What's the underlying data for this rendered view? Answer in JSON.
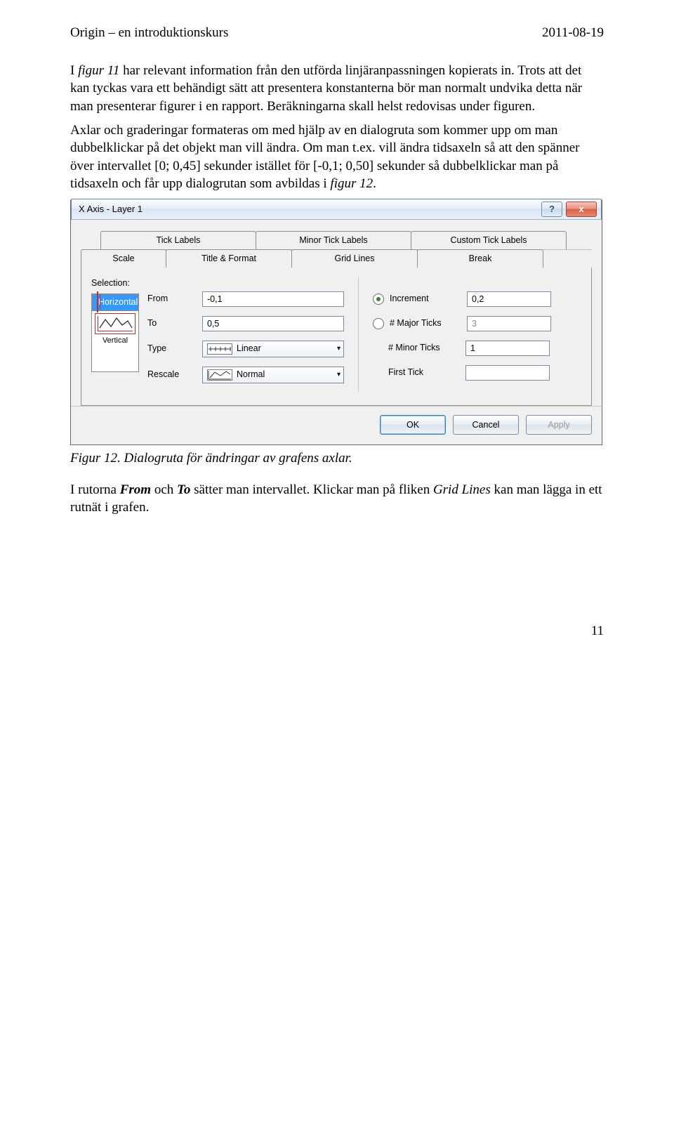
{
  "header": {
    "left": "Origin – en introduktionskurs",
    "right": "2011-08-19"
  },
  "para1_a": "I ",
  "para1_b": "figur 11",
  "para1_c": " har relevant information från den utförda linjäranpassningen kopierats in. Trots att det kan tyckas vara ett behändigt sätt att presentera konstanterna bör man normalt undvika detta när man presenterar figurer i en rapport. Beräkningarna skall helst redovisas under figuren.",
  "para2_a": "Axlar och graderingar formateras om med hjälp av en dialogruta som kommer upp om man dubbelklickar på det objekt man vill ändra. Om man t.ex. vill ändra tidsaxeln så att den spänner över intervallet [0; 0,45] sekunder istället för [-0,1; 0,50] sekunder så dubbelklickar man på tidsaxeln och får upp dialogrutan som avbildas i ",
  "para2_b": "figur 12",
  "para2_c": ".",
  "dialog": {
    "title": "X Axis - Layer 1",
    "help": "?",
    "close": "x",
    "tabs_back": [
      "Tick Labels",
      "Minor Tick Labels",
      "Custom Tick Labels"
    ],
    "tabs_front": [
      "Scale",
      "Title & Format",
      "Grid Lines",
      "Break"
    ],
    "selection_label": "Selection:",
    "selection": {
      "h": "Horizontal",
      "v": "Vertical"
    },
    "left": {
      "from_l": "From",
      "from_v": "-0,1",
      "to_l": "To",
      "to_v": "0,5",
      "type_l": "Type",
      "type_v": "Linear",
      "rescale_l": "Rescale",
      "rescale_v": "Normal"
    },
    "right": {
      "inc_l": "Increment",
      "inc_v": "0,2",
      "maj_l": "# Major Ticks",
      "maj_v": "3",
      "min_l": "# Minor Ticks",
      "min_v": "1",
      "first_l": "First Tick",
      "first_v": ""
    },
    "buttons": {
      "ok": "OK",
      "cancel": "Cancel",
      "apply": "Apply"
    }
  },
  "caption": "Figur 12. Dialogruta för ändringar av grafens axlar.",
  "para3_a": "I rutorna ",
  "para3_b": "From",
  "para3_c": " och ",
  "para3_d": "To",
  "para3_e": " sätter man intervallet. Klickar man på fliken ",
  "para3_f": "Grid Lines",
  "para3_g": " kan man lägga in ett rutnät i grafen.",
  "page_number": "11"
}
